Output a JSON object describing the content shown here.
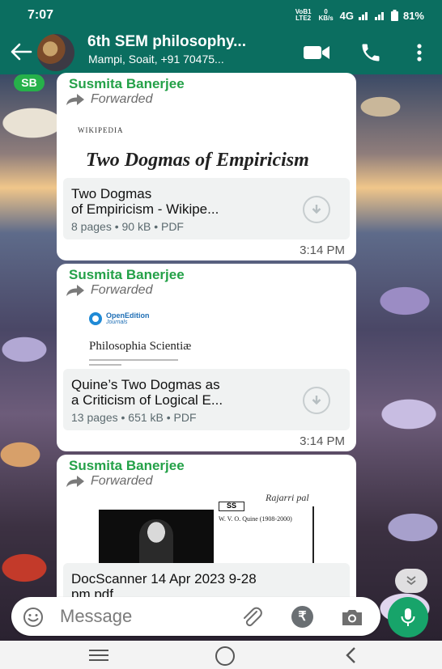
{
  "status_bar": {
    "time": "7:07",
    "volte": "VoB1 LTE2",
    "data_speed": "0 KB/s",
    "network": "4G",
    "battery": "81%"
  },
  "header": {
    "title": "6th SEM philosophy...",
    "subtitle": "Mampi, Soait, +91 70475...",
    "icons": [
      "back-arrow-icon",
      "group-avatar",
      "video-call-icon",
      "phone-call-icon",
      "more-vertical-icon"
    ]
  },
  "sender_initials": "SB",
  "messages": [
    {
      "sender": "Susmita Banerjee",
      "forwarded_label": "Forwarded",
      "preview": {
        "source_label": "WIKIPEDIA",
        "title": "Two Dogmas of Empiricism"
      },
      "doc_name": "Two Dogmas\nof Empiricism - Wikipe...",
      "doc_meta": "8 pages • 90 kB • PDF",
      "time": "3:14 PM"
    },
    {
      "sender": "Susmita Banerjee",
      "forwarded_label": "Forwarded",
      "preview": {
        "logo_text": "OpenEdition",
        "logo_sub": "Journals",
        "title": "Philosophia Scientiæ"
      },
      "doc_name": "Quine’s Two Dogmas as\na Criticism of Logical E...",
      "doc_meta": "13 pages • 651 kB • PDF",
      "time": "3:14 PM"
    },
    {
      "sender": "Susmita Banerjee",
      "forwarded_label": "Forwarded",
      "preview": {
        "handwritten": "Rajarri pal",
        "box_text": "SS",
        "scan_text": "W. V. O. Quine (1908-2000)"
      },
      "doc_name": "DocScanner 14 Apr 2023 9-28\npm.pdf"
    }
  ],
  "input": {
    "placeholder": "Message"
  },
  "colors": {
    "header_bg": "#0b6e60",
    "sender_name": "#24a148",
    "mic_button": "#17a46a"
  }
}
